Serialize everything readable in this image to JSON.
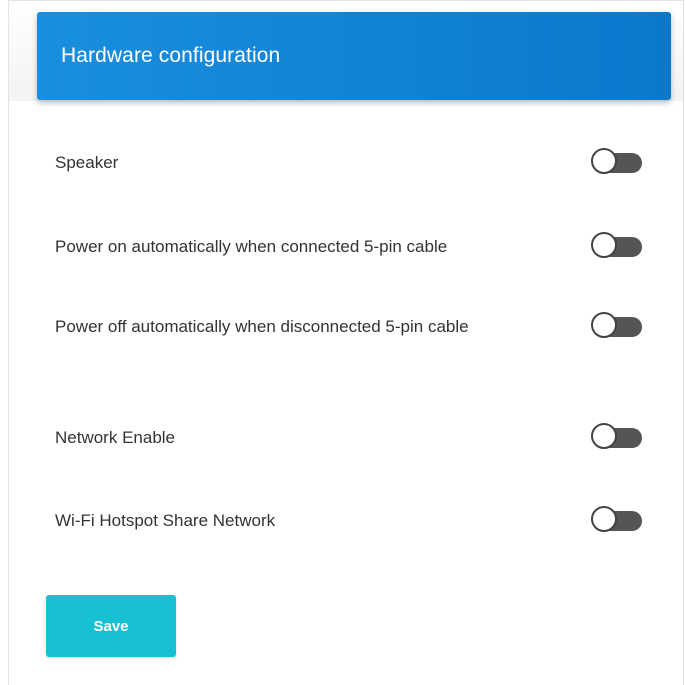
{
  "header": {
    "title": "Hardware configuration"
  },
  "settings": [
    {
      "label": "Speaker",
      "enabled": false
    },
    {
      "label": "Power on automatically when connected 5-pin cable",
      "enabled": false
    },
    {
      "label": "Power off automatically when disconnected 5-pin cable",
      "enabled": false
    },
    {
      "label": "Network Enable",
      "enabled": false
    },
    {
      "label": "Wi-Fi Hotspot Share Network",
      "enabled": false
    }
  ],
  "actions": {
    "save_label": "Save"
  },
  "colors": {
    "header_bg": "#1a8fde",
    "save_bg": "#17c1d3",
    "toggle_track": "#555555"
  }
}
